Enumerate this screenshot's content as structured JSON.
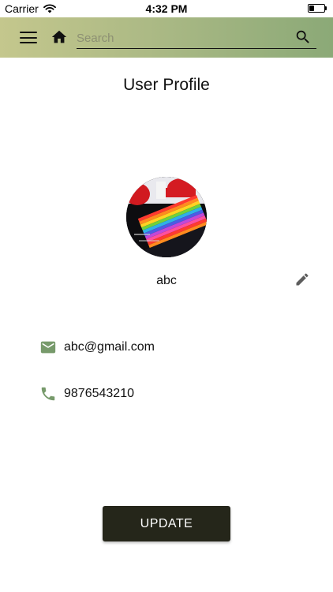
{
  "status_bar": {
    "carrier": "Carrier",
    "time": "4:32 PM",
    "icons": [
      "wifi-icon",
      "battery-icon"
    ]
  },
  "app_bar": {
    "search_placeholder": "Search",
    "search_value": "",
    "icons": [
      "menu-icon",
      "home-icon",
      "search-icon"
    ],
    "gradient_colors": [
      "#c4c78d",
      "#8ba977"
    ]
  },
  "page": {
    "title": "User Profile"
  },
  "profile": {
    "avatar": "profile-photo",
    "name": "abc",
    "email": "abc@gmail.com",
    "phone": "9876543210",
    "edit_icon": "pencil-icon",
    "email_icon": "mail-icon",
    "phone_icon": "phone-icon",
    "icon_color": "#779a6b"
  },
  "actions": {
    "update_label": "UPDATE",
    "button_color": "#25261a"
  }
}
